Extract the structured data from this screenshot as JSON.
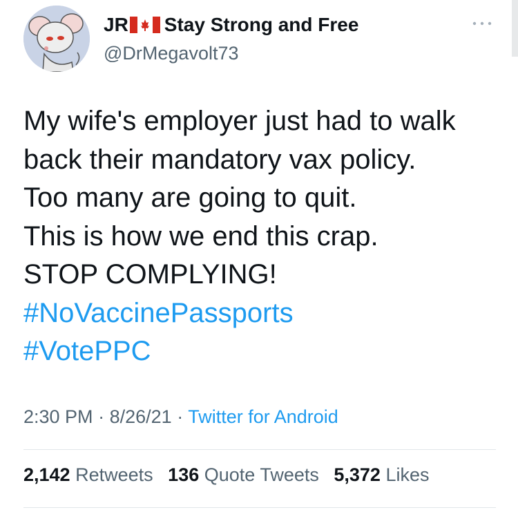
{
  "author": {
    "name_prefix": "JR",
    "name_suffix": "Stay Strong and Free",
    "handle": "@DrMegavolt73",
    "avatar_icon": "cartoon-mouse-avatar-icon",
    "flag_icon": "canada-flag-icon"
  },
  "more_icon": "ellipsis-icon",
  "tweet": {
    "lines": [
      "My wife's employer just had to walk",
      "back their mandatory vax policy.",
      "Too many are going to quit.",
      "This is how we end this crap.",
      "STOP COMPLYING!"
    ],
    "hashtags": [
      "#NoVaccinePassports",
      "#VotePPC"
    ]
  },
  "meta": {
    "time": "2:30 PM",
    "sep1": "·",
    "date": "8/26/21",
    "sep2": "·",
    "source": "Twitter for Android"
  },
  "stats": {
    "retweets_count": "2,142",
    "retweets_label": "Retweets",
    "quotes_count": "136",
    "quotes_label": "Quote Tweets",
    "likes_count": "5,372",
    "likes_label": "Likes"
  },
  "colors": {
    "link": "#1d9bf0",
    "secondary_text": "#536471",
    "primary_text": "#0f1419",
    "divider": "#e1e6ea"
  }
}
